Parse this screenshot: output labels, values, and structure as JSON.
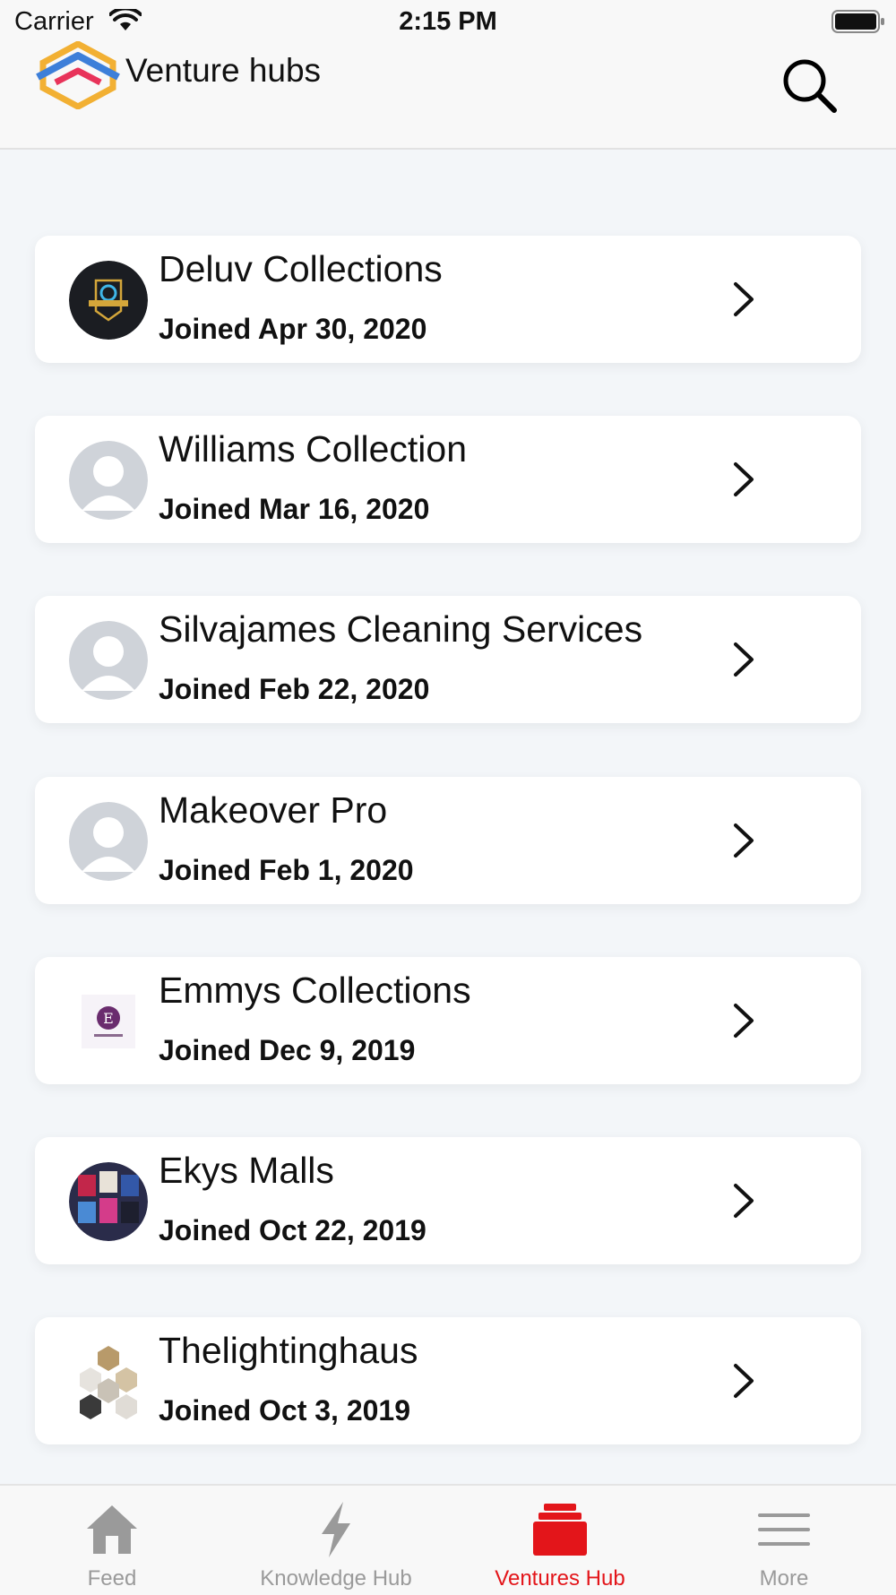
{
  "status_bar": {
    "carrier": "Carrier",
    "time": "2:15 PM"
  },
  "header": {
    "title": "Venture hubs",
    "logo_icon": "venture-hubs-logo",
    "search_icon": "search-icon"
  },
  "ventures": [
    {
      "name": "Deluv Collections",
      "joined": "Joined Apr 30, 2020",
      "avatar": "logo-avatar-dark"
    },
    {
      "name": "Williams Collection",
      "joined": "Joined Mar 16, 2020",
      "avatar": "placeholder-avatar"
    },
    {
      "name": "Silvajames Cleaning Services",
      "joined": "Joined Feb 22, 2020",
      "avatar": "placeholder-avatar"
    },
    {
      "name": "Makeover Pro",
      "joined": "Joined Feb 1, 2020",
      "avatar": "placeholder-avatar"
    },
    {
      "name": "Emmys Collections",
      "joined": "Joined Dec 9, 2019",
      "avatar": "letter-e-logo"
    },
    {
      "name": "Ekys Malls",
      "joined": "Joined Oct 22, 2019",
      "avatar": "photo-avatar"
    },
    {
      "name": "Thelightinghaus",
      "joined": "Joined Oct 3, 2019",
      "avatar": "hexagon-collage-avatar"
    }
  ],
  "tabs": [
    {
      "label": "Feed",
      "icon": "home-icon",
      "active": false
    },
    {
      "label": "Knowledge Hub",
      "icon": "lightning-icon",
      "active": false
    },
    {
      "label": "Ventures Hub",
      "icon": "stack-icon",
      "active": true
    },
    {
      "label": "More",
      "icon": "hamburger-icon",
      "active": false
    }
  ],
  "colors": {
    "accent": "#e3151a",
    "inactive_tab": "#9a9a9a",
    "background": "#f3f6f9",
    "card": "#ffffff"
  }
}
